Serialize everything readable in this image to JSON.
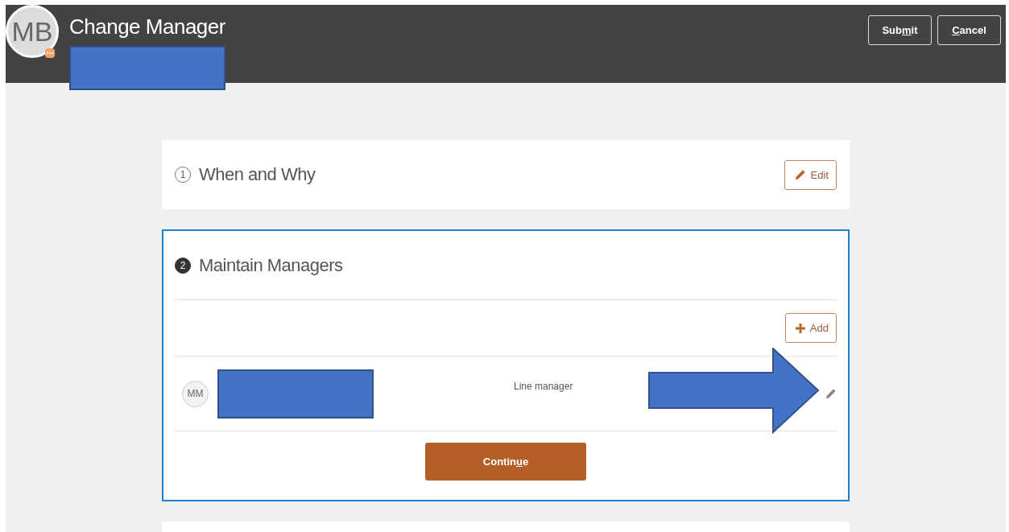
{
  "header": {
    "avatar_initials": "MB",
    "title": "Change Manager",
    "actions": [
      {
        "parts": [
          {
            "text": "Sub",
            "underlined": false
          },
          {
            "text": "m",
            "underlined": true
          },
          {
            "text": "it",
            "underlined": false
          }
        ]
      },
      {
        "parts": [
          {
            "text": "C",
            "underlined": true
          },
          {
            "text": "ancel",
            "underlined": false
          }
        ]
      }
    ]
  },
  "sections": [
    {
      "number": "1",
      "title": "When and Why",
      "active": false,
      "edit_button": "Edit"
    },
    {
      "number": "2",
      "title": "Maintain Managers",
      "active": true,
      "add_button": "Add",
      "managers": [
        {
          "initials": "MM",
          "role": "Line manager"
        }
      ],
      "continue_button": {
        "parts": [
          {
            "text": "Contin",
            "underlined": false
          },
          {
            "text": "u",
            "underlined": true
          },
          {
            "text": "e",
            "underlined": false
          }
        ]
      }
    }
  ]
}
